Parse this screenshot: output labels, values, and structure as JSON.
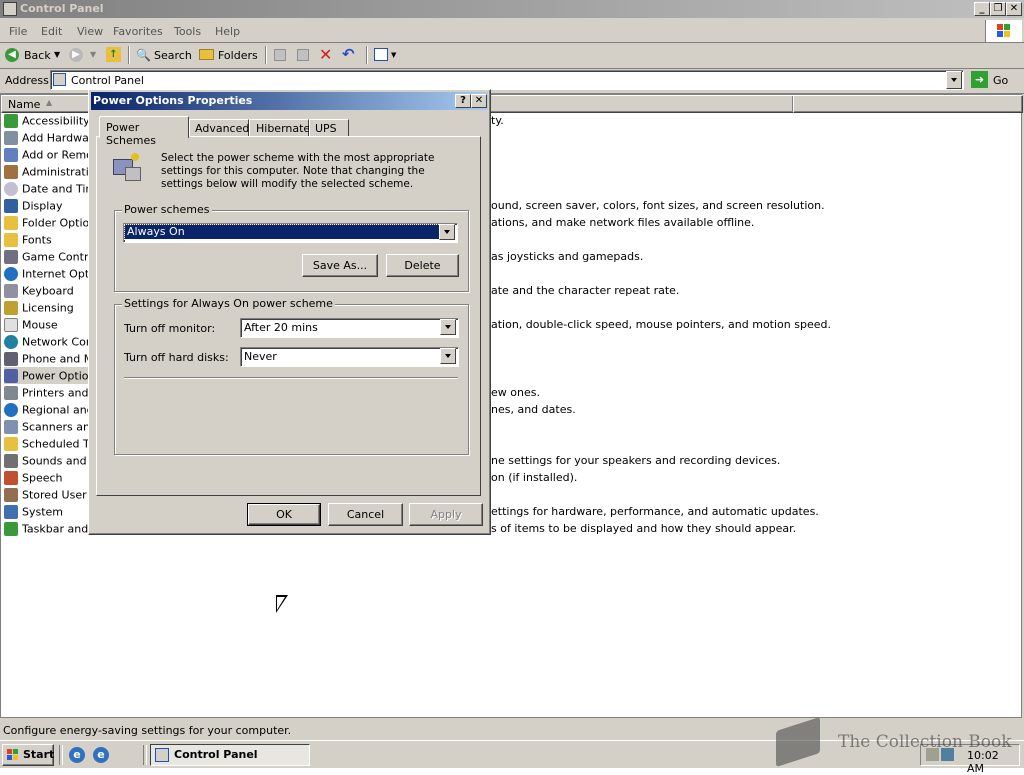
{
  "window": {
    "title": "Control Panel"
  },
  "menu": [
    "File",
    "Edit",
    "View",
    "Favorites",
    "Tools",
    "Help"
  ],
  "toolbar": {
    "back": "Back",
    "search": "Search",
    "folders": "Folders"
  },
  "address": {
    "label": "Address",
    "value": "Control Panel",
    "go": "Go"
  },
  "columns": {
    "name": "Name"
  },
  "items": [
    {
      "label": "Accessibility Options",
      "desc": "ty."
    },
    {
      "label": "Add Hardware",
      "desc": ""
    },
    {
      "label": "Add or Remove Programs",
      "desc": ""
    },
    {
      "label": "Administrative Tools",
      "desc": ""
    },
    {
      "label": "Date and Time",
      "desc": ""
    },
    {
      "label": "Display",
      "desc": "ound, screen saver, colors, font sizes, and screen resolution."
    },
    {
      "label": "Folder Options",
      "desc": "ations, and make network files available offline."
    },
    {
      "label": "Fonts",
      "desc": ""
    },
    {
      "label": "Game Controllers",
      "desc": "as joysticks and gamepads."
    },
    {
      "label": "Internet Options",
      "desc": ""
    },
    {
      "label": "Keyboard",
      "desc": "ate and the character repeat rate."
    },
    {
      "label": "Licensing",
      "desc": ""
    },
    {
      "label": "Mouse",
      "desc": "ation, double-click speed, mouse pointers, and motion speed."
    },
    {
      "label": "Network Connections",
      "desc": ""
    },
    {
      "label": "Phone and Modem Options",
      "desc": ""
    },
    {
      "label": "Power Options",
      "desc": ""
    },
    {
      "label": "Printers and Faxes",
      "desc": "ew ones."
    },
    {
      "label": "Regional and Language Options",
      "desc": "nes, and dates."
    },
    {
      "label": "Scanners and Cameras",
      "desc": ""
    },
    {
      "label": "Scheduled Tasks",
      "desc": ""
    },
    {
      "label": "Sounds and Audio Devices",
      "desc": "ne settings for your speakers and recording devices."
    },
    {
      "label": "Speech",
      "desc": "on (if installed)."
    },
    {
      "label": "Stored User Names and Passwords",
      "desc": ""
    },
    {
      "label": "System",
      "desc": "ettings for hardware, performance, and automatic updates."
    },
    {
      "label": "Taskbar and Start Menu",
      "desc": "s of items to be displayed and how they should appear."
    }
  ],
  "status": {
    "text": "Configure energy-saving settings for your computer."
  },
  "taskbar": {
    "start": "Start",
    "task": "Control Panel",
    "clock": "10:02 AM"
  },
  "watermark": "The Collection Book",
  "dialog": {
    "title": "Power Options Properties",
    "help_btn": "?",
    "close_btn": "✕",
    "tabs": [
      "Power Schemes",
      "Advanced",
      "Hibernate",
      "UPS"
    ],
    "intro": "Select the power scheme with the most appropriate settings for this computer. Note that changing the settings below will modify the selected scheme.",
    "schemes_group": "Power schemes",
    "scheme_value": "Always On",
    "save_as": "Save As...",
    "delete": "Delete",
    "settings_group": "Settings for Always On power scheme",
    "monitor_label": "Turn off monitor:",
    "monitor_value": "After 20 mins",
    "disks_label": "Turn off hard disks:",
    "disks_value": "Never",
    "ok": "OK",
    "cancel": "Cancel",
    "apply": "Apply"
  },
  "colors": {
    "titlebar_inactive": "#808080",
    "dialog_title_start": "#0a246a",
    "dialog_title_end": "#a6caf0",
    "face": "#d4d0c8",
    "selection": "#0a246a"
  }
}
